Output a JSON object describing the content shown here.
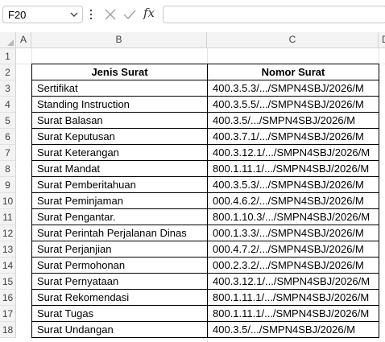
{
  "formula_bar": {
    "name_box": "F20",
    "fx_label": "fx",
    "formula": ""
  },
  "columns": [
    "A",
    "B",
    "C",
    "D"
  ],
  "rows": [
    "1",
    "2",
    "3",
    "4",
    "5",
    "6",
    "7",
    "8",
    "9",
    "10",
    "11",
    "12",
    "13",
    "14",
    "15",
    "16",
    "17",
    "18"
  ],
  "table": {
    "headers": [
      "Jenis Surat",
      "Nomor Surat"
    ],
    "rows": [
      [
        "Sertifikat",
        "400.3.5.3/.../SMPN4SBJ/2026/M"
      ],
      [
        "Standing Instruction",
        "400.3.5.5/.../SMPN4SBJ/2026/M"
      ],
      [
        "Surat Balasan",
        "400.3.5/.../SMPN4SBJ/2026/M"
      ],
      [
        "Surat Keputusan",
        "400.3.7.1/.../SMPN4SBJ/2026/M"
      ],
      [
        "Surat Keterangan",
        "400.3.12.1/.../SMPN4SBJ/2026/M"
      ],
      [
        "Surat Mandat",
        "800.1.11.1/.../SMPN4SBJ/2026/M"
      ],
      [
        "Surat Pemberitahuan",
        "400.3.5.3/.../SMPN4SBJ/2026/M"
      ],
      [
        "Surat Peminjaman",
        "000.4.6.2/.../SMPN4SBJ/2026/M"
      ],
      [
        "Surat Pengantar.",
        "800.1.10.3/.../SMPN4SBJ/2026/M"
      ],
      [
        "Surat Perintah Perjalanan Dinas",
        "000.1.3.3/.../SMPN4SBJ/2026/M"
      ],
      [
        "Surat Perjanjian",
        "000.4.7.2/.../SMPN4SBJ/2026/M"
      ],
      [
        "Surat Permohonan",
        "000.2.3.2/.../SMPN4SBJ/2026/M"
      ],
      [
        "Surat Pernyataan",
        "400.3.12.1/.../SMPN4SBJ/2026/M"
      ],
      [
        "Surat Rekomendasi",
        "800.1.11.1/.../SMPN4SBJ/2026/M"
      ],
      [
        "Surat Tugas",
        "800.1.11.1/.../SMPN4SBJ/2026/M"
      ],
      [
        "Surat Undangan",
        "400.3.5/.../SMPN4SBJ/2026/M"
      ]
    ]
  }
}
